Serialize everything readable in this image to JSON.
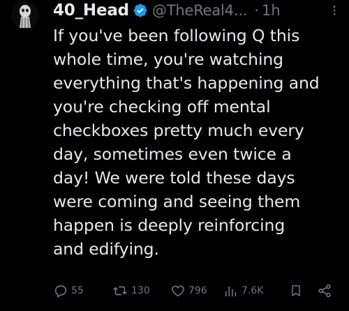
{
  "tweet": {
    "display_name": "40_Head",
    "handle": "@TheReal4...",
    "separator": "·",
    "time": "1h",
    "text": "If you've been following Q this\nwhole time, you're watching\neverything that's happening and\nyou're checking off mental\ncheckboxes pretty much every\nday, sometimes even twice a\nday! We were told these days\nwere coming and seeing them\nhappen is deeply reinforcing\nand edifying."
  },
  "actions": {
    "reply_count": "55",
    "retweet_count": "130",
    "like_count": "796",
    "views_count": "7.6K"
  },
  "icons": {
    "verified": "verified-badge-icon",
    "more": "more-options-icon",
    "reply": "reply-icon",
    "retweet": "retweet-icon",
    "like": "heart-icon",
    "views": "views-icon",
    "bookmark": "bookmark-icon",
    "share": "share-icon"
  },
  "colors": {
    "background": "#000000",
    "text": "#e7e9ea",
    "muted": "#71767b",
    "verified": "#1d9bf0"
  }
}
